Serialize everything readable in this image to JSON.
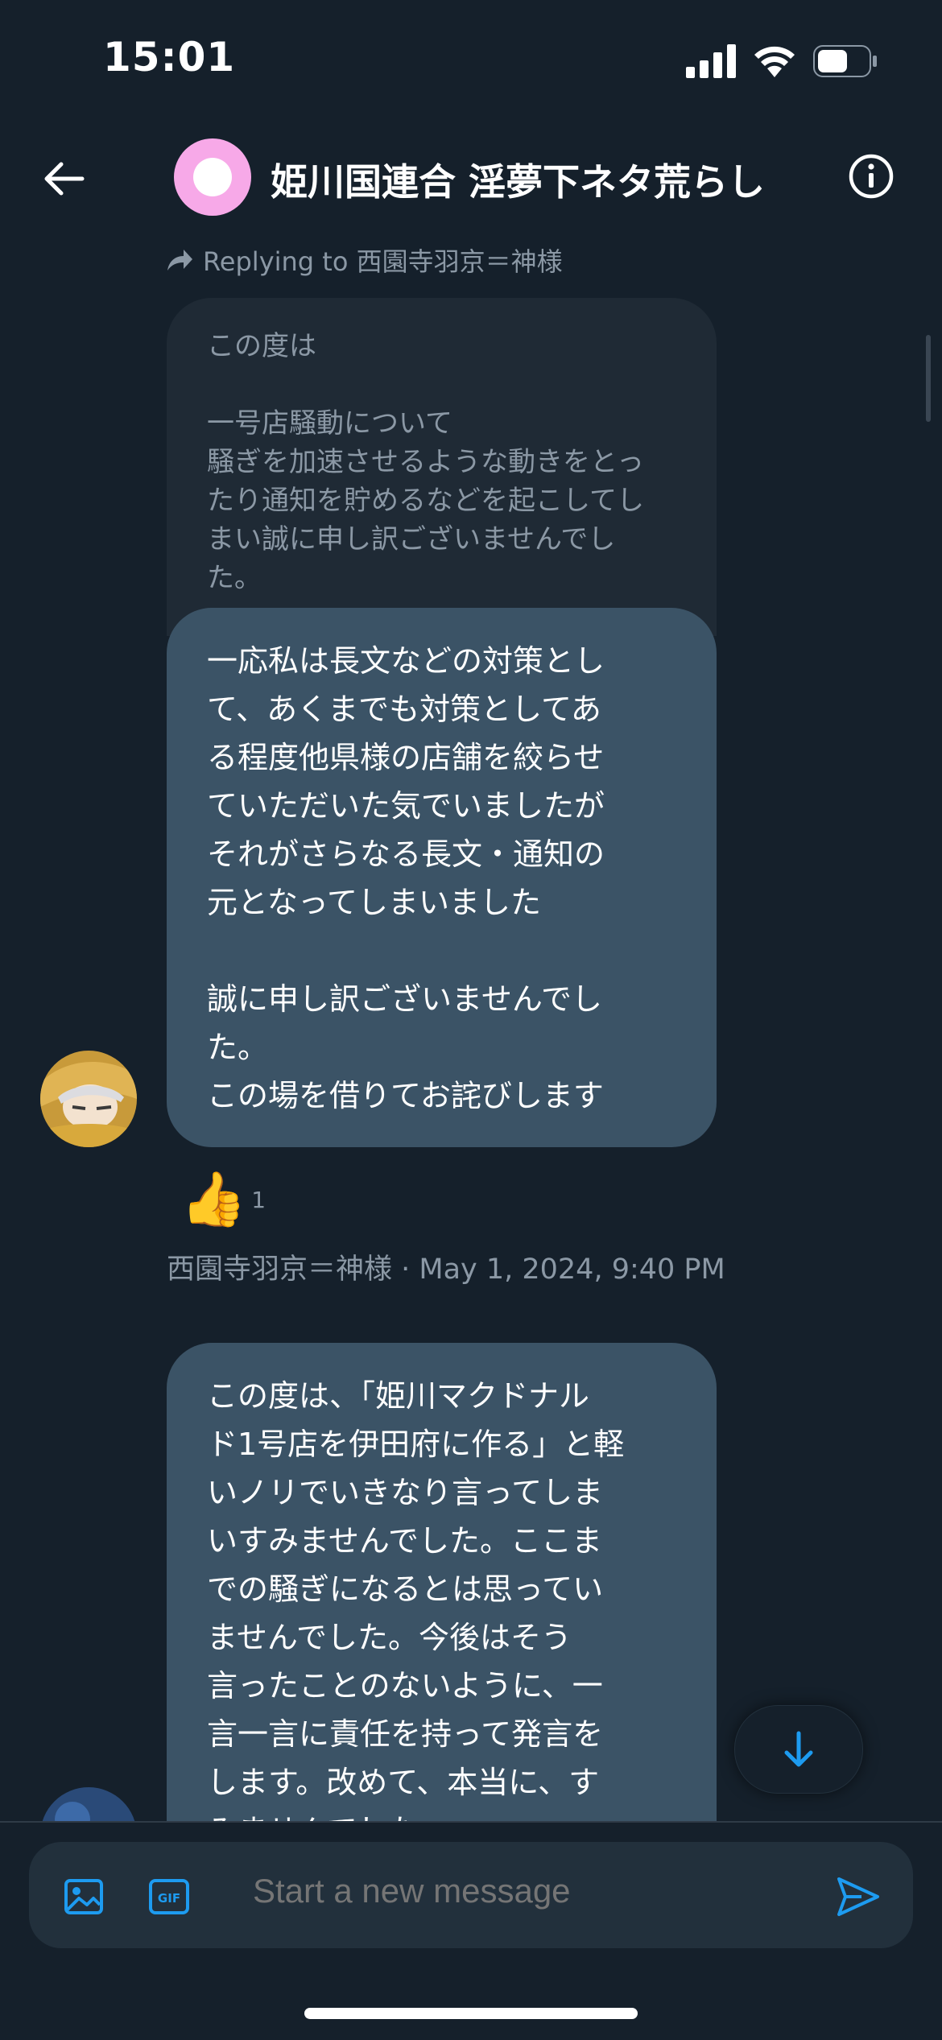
{
  "status_bar": {
    "time": "15:01"
  },
  "header": {
    "title": "姫川国連合 淫夢下ネタ荒らし"
  },
  "reply": {
    "label": "Replying to 西園寺羽京＝神様"
  },
  "quoted_message": {
    "lines": [
      "この度は",
      "",
      "一号店騒動について",
      "騒ぎを加速させるような動きをとっ",
      "たり通知を貯めるなどを起こしてし",
      "まい誠に申し訳ございませんでし",
      "た。"
    ]
  },
  "message_1": {
    "lines": [
      "一応私は長文などの対策とし",
      "て、あくまでも対策としてあ",
      "る程度他県様の店舗を絞らせ",
      "ていただいた気でいましたが",
      "それがさらなる長文・通知の",
      "元となってしまいました",
      "",
      "誠に申し訳ございませんでし",
      "た。",
      "この場を借りてお詫びします"
    ]
  },
  "reaction": {
    "emoji": "👍",
    "count": "1"
  },
  "message_meta": "西園寺羽京＝神様 · May 1, 2024, 9:40 PM",
  "message_2": {
    "lines": [
      "この度は、「姫川マクドナル",
      "ド1号店を伊田府に作る」と軽",
      "いノリでいきなり言ってしま",
      "いすみませんでした。ここま",
      "での騒ぎになるとは思ってい",
      "ませんでした。今後はそう",
      "言ったことのないように、一",
      "言一言に責任を持って発言を",
      "します。改めて、本当に、す",
      "みませんでした。"
    ]
  },
  "composer": {
    "placeholder": "Start a new message"
  },
  "icons": {
    "back": "arrow-left-icon",
    "info": "info-icon",
    "reply": "reply-arrow-icon",
    "image": "image-icon",
    "gif": "gif-icon",
    "send": "send-icon",
    "scroll_down": "arrow-down-icon"
  },
  "colors": {
    "accent": "#1d9bf0",
    "bubble": "#3b5366",
    "background": "#15202b",
    "avatar_pink": "#f7a9e8"
  }
}
